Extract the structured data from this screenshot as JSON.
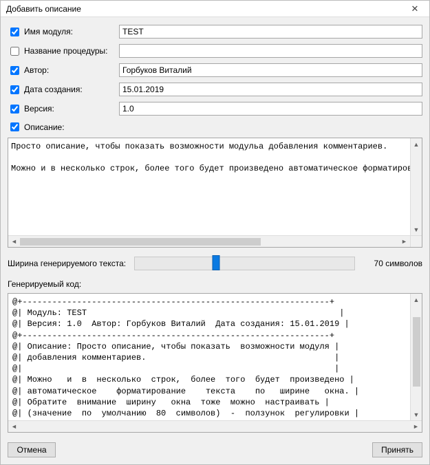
{
  "window": {
    "title": "Добавить описание"
  },
  "fields": {
    "module": {
      "label": "Имя модуля:",
      "checked": true,
      "value": "TEST"
    },
    "proc": {
      "label": "Название процедуры:",
      "checked": false,
      "value": ""
    },
    "author": {
      "label": "Автор:",
      "checked": true,
      "value": "Горбуков Виталий"
    },
    "date": {
      "label": "Дата создания:",
      "checked": true,
      "value": "15.01.2019"
    },
    "version": {
      "label": "Версия:",
      "checked": true,
      "value": "1.0"
    },
    "desc": {
      "label": "Описание:",
      "checked": true
    }
  },
  "description_text": "Просто описание, чтобы показать возможности модульа добавления комментариев.\n\nМожно и в несколько строк, более того будет произведено автоматическое форматировани",
  "slider": {
    "label": "Ширина генерируемого текста:",
    "value": 70,
    "display": "70 символов",
    "min": 40,
    "max": 120,
    "thumb_percent": 37
  },
  "generated_label": "Генерируемый код:",
  "generated_code": "@+--------------------------------------------------------------+\n@| Модуль: TEST                                                   |\n@| Версия: 1.0  Автор: Горбуков Виталий  Дата создания: 15.01.2019 |\n@+--------------------------------------------------------------+\n@| Описание: Просто описание, чтобы показать  возможности модуля |\n@| добавления комментариев.                                      |\n@|                                                               |\n@| Можно   и  в  несколько  строк,  более  того  будет  произведено |\n@| автоматическое    форматирование    текста    по   ширине   окна. |\n@| Обратите  внимание  ширину   окна  тоже  можно  настраивать |\n@| (значение  по  умолчанию  80  символов)  -  ползунок  регулировки |\n@|   прямо   на   этим   окном                                   |",
  "buttons": {
    "cancel": "Отмена",
    "accept": "Принять"
  }
}
